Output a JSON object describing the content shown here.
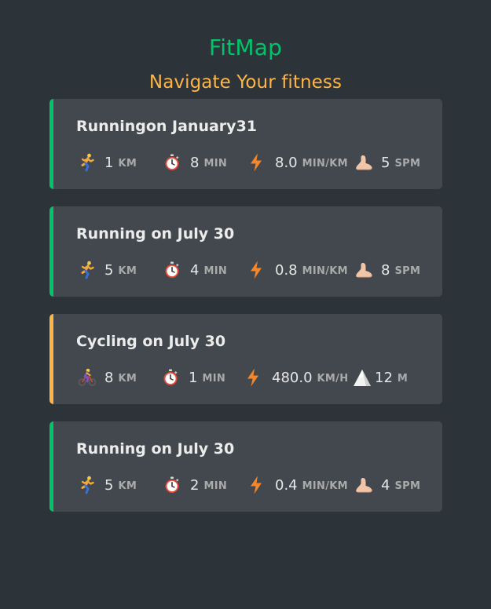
{
  "header": {
    "title": "FitMap",
    "subtitle": "Navigate Your fitness"
  },
  "colors": {
    "running_accent": "#00c46a",
    "cycling_accent": "#ffb545",
    "background": "#2d3439",
    "card": "#42484d"
  },
  "workouts": [
    {
      "type": "running",
      "title": "Runningon January31",
      "distance": {
        "icon": "runner-icon",
        "value": "1",
        "unit": "KM"
      },
      "duration": {
        "icon": "stopwatch-icon",
        "value": "8",
        "unit": "MIN"
      },
      "speed": {
        "icon": "lightning-icon",
        "value": "8.0",
        "unit": "MIN/KM"
      },
      "extra": {
        "icon": "foot-icon",
        "value": "5",
        "unit": "SPM"
      }
    },
    {
      "type": "running",
      "title": "Running on July 30",
      "distance": {
        "icon": "runner-icon",
        "value": "5",
        "unit": "KM"
      },
      "duration": {
        "icon": "stopwatch-icon",
        "value": "4",
        "unit": "MIN"
      },
      "speed": {
        "icon": "lightning-icon",
        "value": "0.8",
        "unit": "MIN/KM"
      },
      "extra": {
        "icon": "foot-icon",
        "value": "8",
        "unit": "SPM"
      }
    },
    {
      "type": "cycling",
      "title": "Cycling on July 30",
      "distance": {
        "icon": "cyclist-icon",
        "value": "8",
        "unit": "KM"
      },
      "duration": {
        "icon": "stopwatch-icon",
        "value": "1",
        "unit": "MIN"
      },
      "speed": {
        "icon": "lightning-icon",
        "value": "480.0",
        "unit": "KM/H"
      },
      "extra": {
        "icon": "mountain-icon",
        "value": "12",
        "unit": "M"
      }
    },
    {
      "type": "running",
      "title": "Running on July 30",
      "distance": {
        "icon": "runner-icon",
        "value": "5",
        "unit": "KM"
      },
      "duration": {
        "icon": "stopwatch-icon",
        "value": "2",
        "unit": "MIN"
      },
      "speed": {
        "icon": "lightning-icon",
        "value": "0.4",
        "unit": "MIN/KM"
      },
      "extra": {
        "icon": "foot-icon",
        "value": "4",
        "unit": "SPM"
      }
    }
  ]
}
